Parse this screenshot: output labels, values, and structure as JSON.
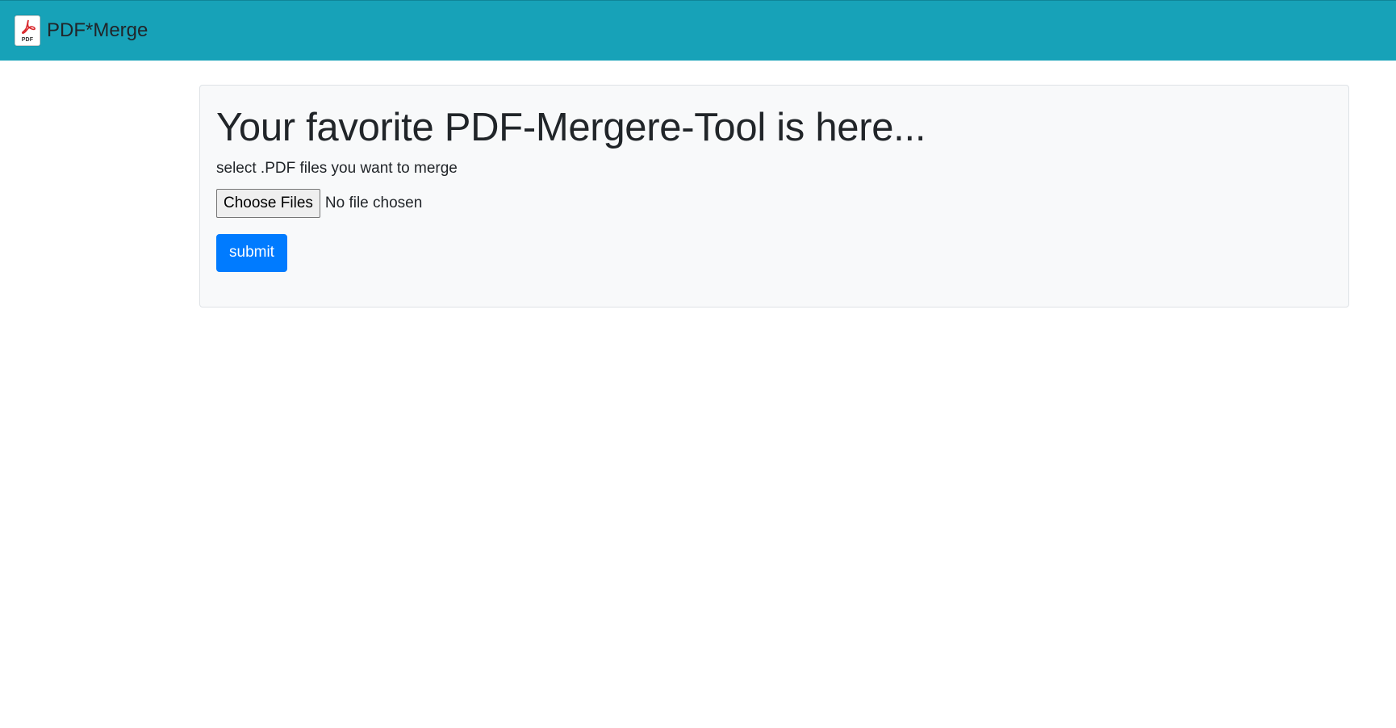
{
  "navbar": {
    "brand_name": "PDF*Merge",
    "logo_icon": "pdf-file-icon",
    "logo_label": "PDF",
    "background_color": "#17a2b8"
  },
  "main": {
    "title": "Your favorite PDF-Mergere-Tool is here...",
    "subtitle": "select .PDF files you want to merge",
    "file_input": {
      "button_label": "Choose Files",
      "status_text": "No file chosen"
    },
    "submit_label": "submit",
    "submit_color": "#007bff",
    "panel_background": "#f8f9fa"
  }
}
